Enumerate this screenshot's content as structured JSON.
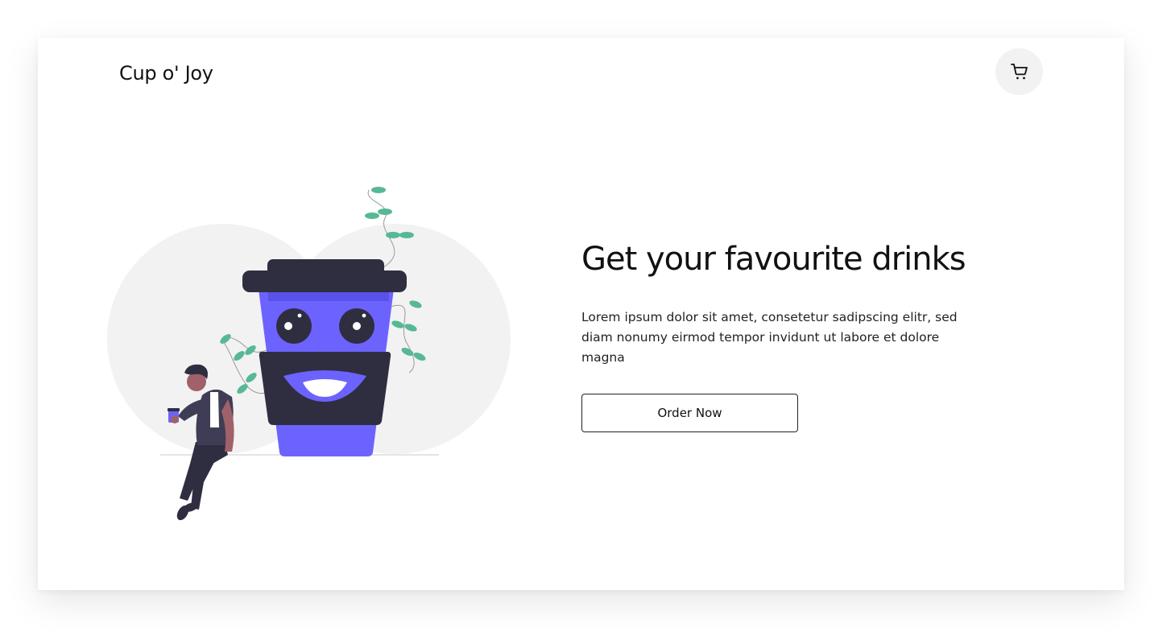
{
  "brand": {
    "name": "Cup o' Joy"
  },
  "header": {
    "cart_icon": "shopping-cart-icon"
  },
  "hero": {
    "title": "Get your favourite drinks",
    "description": "Lorem ipsum dolor sit amet, consetetur sadipscing elitr, sed diam nonumy eirmod tempor invidunt ut labore et dolore magna",
    "cta_label": "Order Now",
    "illustration": "coffee-cup-character-illustration"
  },
  "colors": {
    "accent": "#6c63ff",
    "dark": "#2f2e41",
    "leaf": "#57b894",
    "circle_bg": "#f2f2f2"
  }
}
